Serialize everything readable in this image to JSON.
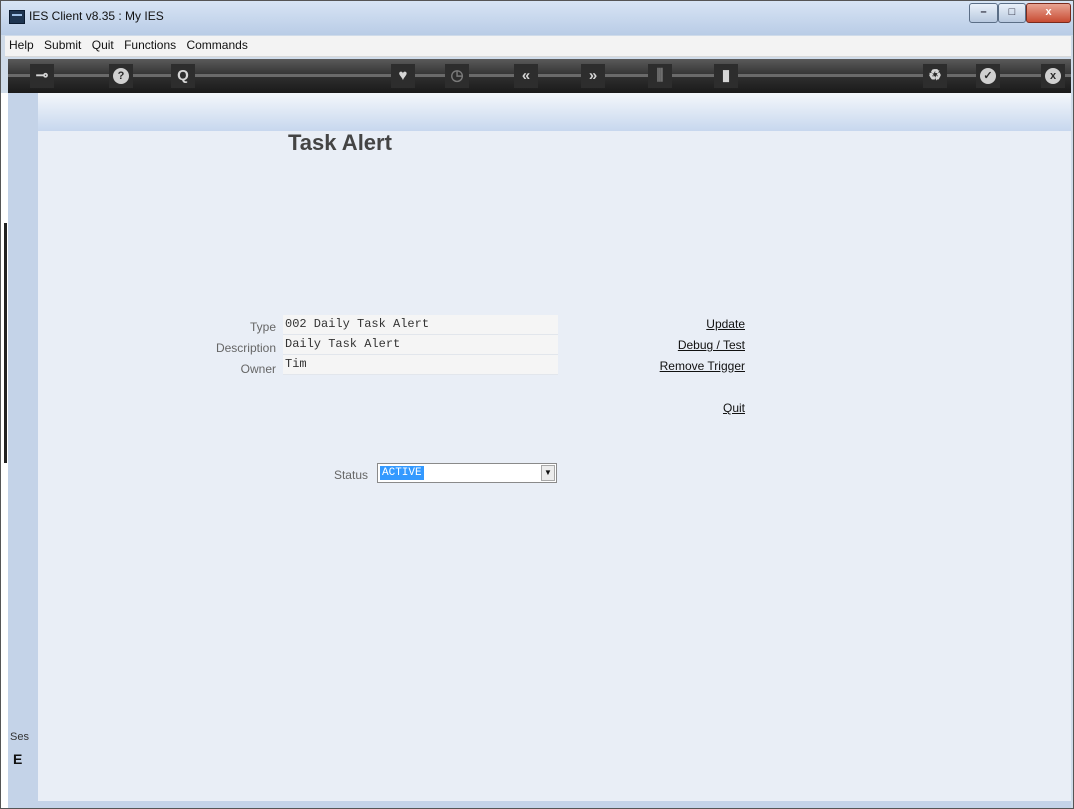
{
  "window": {
    "title": "IES Client v8.35 : My IES",
    "min_glyph": "–",
    "max_glyph": "□",
    "close_glyph": "x"
  },
  "menu": {
    "items": [
      "Help",
      "Submit",
      "Quit",
      "Functions",
      "Commands"
    ]
  },
  "toolbar": {
    "icons": [
      {
        "name": "key-icon",
        "glyph": "⊸"
      },
      {
        "name": "help-icon",
        "glyph": "?"
      },
      {
        "name": "search-icon",
        "glyph": "Q"
      },
      {
        "name": "heart-icon",
        "glyph": "♥"
      },
      {
        "name": "clock-icon",
        "glyph": "◷"
      },
      {
        "name": "back-icon",
        "glyph": "«"
      },
      {
        "name": "forward-icon",
        "glyph": "»"
      },
      {
        "name": "tools-icon",
        "glyph": "⫼"
      },
      {
        "name": "page-icon",
        "glyph": "▮"
      },
      {
        "name": "recycle-icon",
        "glyph": "♻"
      },
      {
        "name": "check-icon",
        "glyph": "✓"
      },
      {
        "name": "close-icon",
        "glyph": "x"
      }
    ]
  },
  "sidebar": {
    "session_label": "Ses",
    "glyph": "E"
  },
  "page": {
    "title": "Task Alert",
    "fields": {
      "type_label": "Type",
      "type_value": "002 Daily Task Alert",
      "description_label": "Description",
      "description_value": "Daily Task Alert",
      "owner_label": "Owner",
      "owner_value": "Tim"
    },
    "actions": {
      "update": "Update",
      "debug": "Debug / Test",
      "remove": "Remove Trigger",
      "quit": "Quit"
    },
    "status": {
      "label": "Status",
      "value": "ACTIVE"
    }
  }
}
